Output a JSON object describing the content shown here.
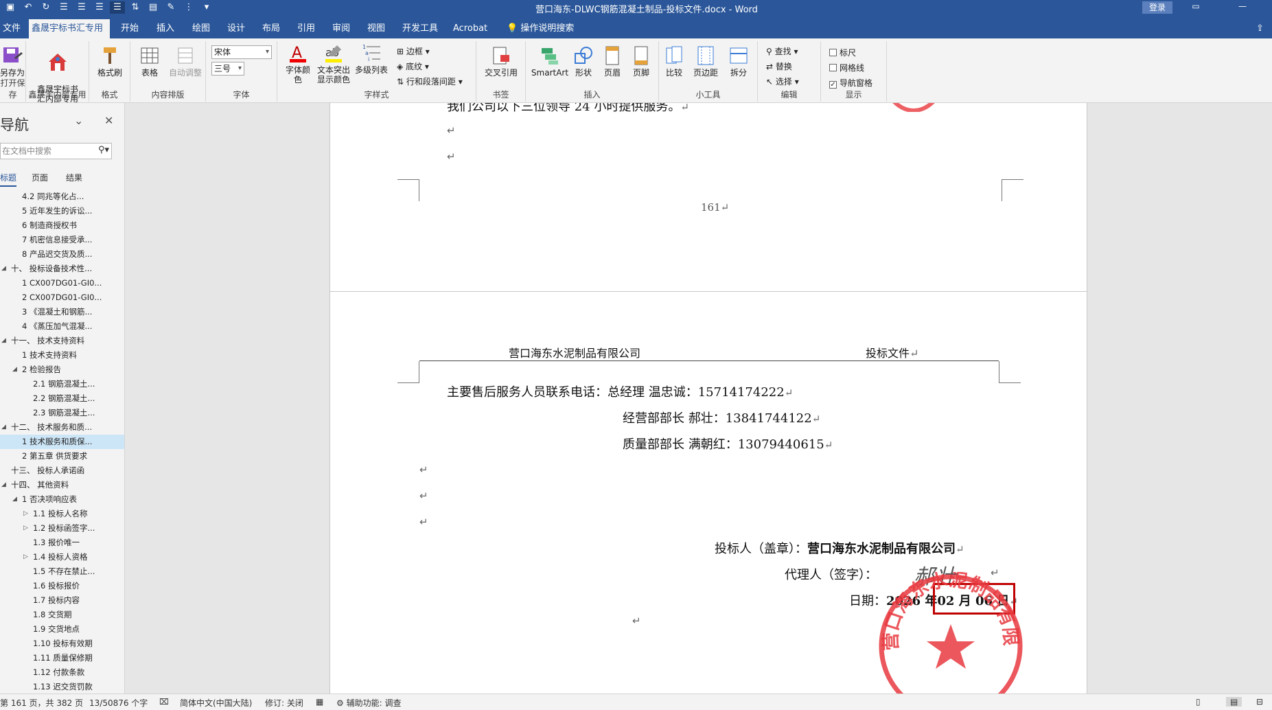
{
  "titlebar": {
    "title": "营口海东-DLWC钢筋混凝土制品-投标文件.docx  -  Word",
    "login": "登录"
  },
  "tabs": [
    "文件",
    "鑫晟宇标书汇专用",
    "开始",
    "插入",
    "绘图",
    "设计",
    "布局",
    "引用",
    "审阅",
    "视图",
    "开发工具",
    "Acrobat"
  ],
  "tell_me": "操作说明搜索",
  "ribbon": {
    "save_as": "另存为",
    "group_save": "打开保存",
    "xin_btn": "鑫晟宇标书\n汇内部专用",
    "group_xin": "鑫晟宇内部专用",
    "format_painter": "格式刷",
    "group_format": "格式",
    "table": "表格",
    "auto_adjust": "自动调整",
    "group_content": "内容排版",
    "font_name": "宋体",
    "font_size": "三号",
    "group_font": "字体",
    "font_color": "字体颜色",
    "highlight": "文本突出显示颜色",
    "multilevel": "多级列表",
    "border": "边框",
    "shading": "底纹",
    "spacing": "行和段落间距",
    "group_style": "字样式",
    "crossref": "交叉引用",
    "group_bookmark": "书签",
    "smartart": "SmartArt",
    "shape": "形状",
    "header": "页眉",
    "footer": "页脚",
    "group_insert": "插入",
    "compare": "比较",
    "margins": "页边距",
    "split": "拆分",
    "group_tools": "小工具",
    "find": "查找",
    "replace": "替换",
    "select": "选择",
    "group_edit": "编辑",
    "ruler": "标尺",
    "gridlines": "网格线",
    "navpane": "导航窗格",
    "group_show": "显示"
  },
  "nav": {
    "title": "导航",
    "search_placeholder": "在文档中搜索",
    "tabs": [
      "标题",
      "页面",
      "结果"
    ],
    "items": [
      {
        "text": "4.2 同兆等化占...",
        "level": 2
      },
      {
        "text": "5 近年发生的诉讼...",
        "level": 2
      },
      {
        "text": "6 制造商授权书",
        "level": 2
      },
      {
        "text": "7 机密信息接受承...",
        "level": 2
      },
      {
        "text": "8 产品迟交货及质...",
        "level": 2
      },
      {
        "text": "十、 投标设备技术性...",
        "level": 1,
        "tri": "◢"
      },
      {
        "text": "1 CX007DG01-GI0...",
        "level": 2
      },
      {
        "text": "2 CX007DG01-GI0...",
        "level": 2
      },
      {
        "text": "3 《混凝土和钢筋...",
        "level": 2
      },
      {
        "text": "4 《蒸压加气混凝...",
        "level": 2
      },
      {
        "text": "十一、 技术支持资料",
        "level": 1,
        "tri": "◢"
      },
      {
        "text": "1 技术支持资料",
        "level": 2
      },
      {
        "text": "2 检验报告",
        "level": 2,
        "tri": "◢"
      },
      {
        "text": "2.1 钢筋混凝土...",
        "level": 3
      },
      {
        "text": "2.2 钢筋混凝土...",
        "level": 3
      },
      {
        "text": "2.3 钢筋混凝土...",
        "level": 3
      },
      {
        "text": "十二、 技术服务和质...",
        "level": 1,
        "tri": "◢"
      },
      {
        "text": "1 技术服务和质保...",
        "level": 2,
        "selected": true
      },
      {
        "text": "2 第五章  供货要求",
        "level": 2
      },
      {
        "text": "十三、 投标人承诺函",
        "level": 1
      },
      {
        "text": "十四、 其他资料",
        "level": 1,
        "tri": "◢"
      },
      {
        "text": "1 否决项响应表",
        "level": 2,
        "tri": "◢"
      },
      {
        "text": "1.1 投标人名称",
        "level": 3,
        "tri": "▷"
      },
      {
        "text": "1.2 投标函签字...",
        "level": 3,
        "tri": "▷"
      },
      {
        "text": "1.3 报价唯一",
        "level": 3
      },
      {
        "text": "1.4 投标人资格",
        "level": 3,
        "tri": "▷"
      },
      {
        "text": "1.5 不存在禁止...",
        "level": 3
      },
      {
        "text": "1.6 投标报价",
        "level": 3
      },
      {
        "text": "1.7 投标内容",
        "level": 3
      },
      {
        "text": "1.8 交货期",
        "level": 3
      },
      {
        "text": "1.9 交货地点",
        "level": 3
      },
      {
        "text": "1.10 投标有效期",
        "level": 3
      },
      {
        "text": "1.11 质量保修期",
        "level": 3
      },
      {
        "text": "1.12 付款条款",
        "level": 3
      },
      {
        "text": "1.13 迟交货罚款",
        "level": 3
      }
    ]
  },
  "doc": {
    "page1_line": "我们公司以下三位领导 24 小时提供服务。",
    "page_number": "161",
    "header_left": "营口海东水泥制品有限公司",
    "header_right": "投标文件",
    "contact_line1": "主要售后服务人员联系电话：总经理     温忠诚：15714174222",
    "contact_line2": "经营部部长  郝壮：13841744122",
    "contact_line3": "质量部部长  满朝红：13079440615",
    "bidder_label": "投标人（盖章）：",
    "bidder_name": "营口海东水泥制品有限公司",
    "agent_label": "代理人（签字）：",
    "signature": "郝壮",
    "date_label": "日期：",
    "date_year": "2026 年",
    "date_rest": "02 月 06 日",
    "stamp_text": "营口海东水泥制品有限公司",
    "return_mark": "↵"
  },
  "status": {
    "page": "第 161 页，共 382 页",
    "words": "13/50876 个字",
    "lang": "简体中文(中国大陆)",
    "track": "修订: 关闭",
    "access": "辅助功能: 调查"
  },
  "colors": {
    "word_blue": "#2b579a",
    "stamp_red": "#e8393f",
    "highlight_box": "#c00000"
  }
}
